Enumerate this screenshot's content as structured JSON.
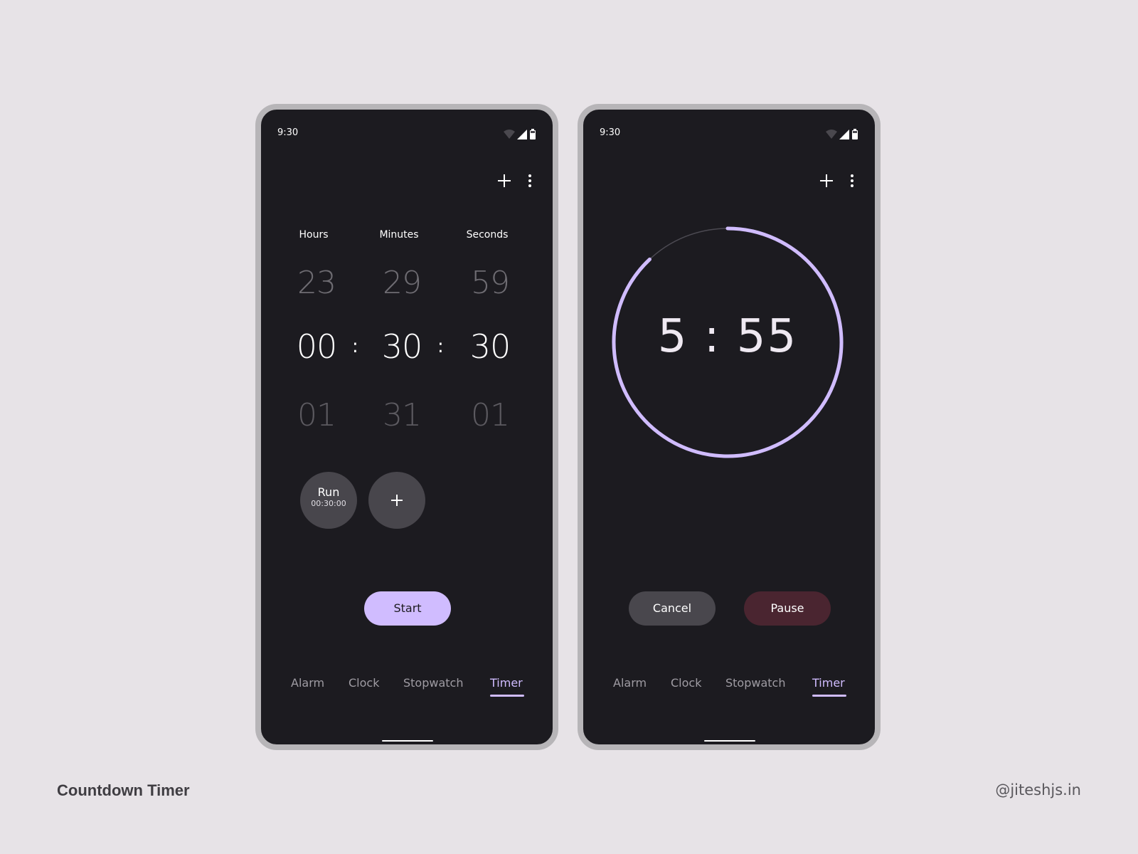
{
  "page": {
    "title": "Countdown Timer",
    "credit": "@jiteshjs.in"
  },
  "status_bar": {
    "time": "9:30"
  },
  "icons": {
    "add": "plus-icon",
    "more": "more-vert-icon",
    "wifi": "wifi-icon",
    "signal": "cell-signal-icon",
    "battery": "battery-icon"
  },
  "picker": {
    "columns": [
      {
        "label": "Hours",
        "prev": "23",
        "value": "00",
        "next": "01"
      },
      {
        "label": "Minutes",
        "prev": "29",
        "value": "30",
        "next": "31"
      },
      {
        "label": "Seconds",
        "prev": "59",
        "value": "30",
        "next": "01"
      }
    ],
    "separator": ":",
    "preset": {
      "label": "Run",
      "time": "00:30:00"
    },
    "start_label": "Start"
  },
  "running": {
    "remaining": "5 : 55",
    "progress_fraction": 0.88,
    "cancel_label": "Cancel",
    "pause_label": "Pause"
  },
  "nav": {
    "items": [
      "Alarm",
      "Clock",
      "Stopwatch",
      "Timer"
    ],
    "active": "Timer"
  },
  "colors": {
    "accent": "#d0bcff",
    "screen": "#1c1b20",
    "pause": "#4a2530",
    "button": "#48464c"
  }
}
